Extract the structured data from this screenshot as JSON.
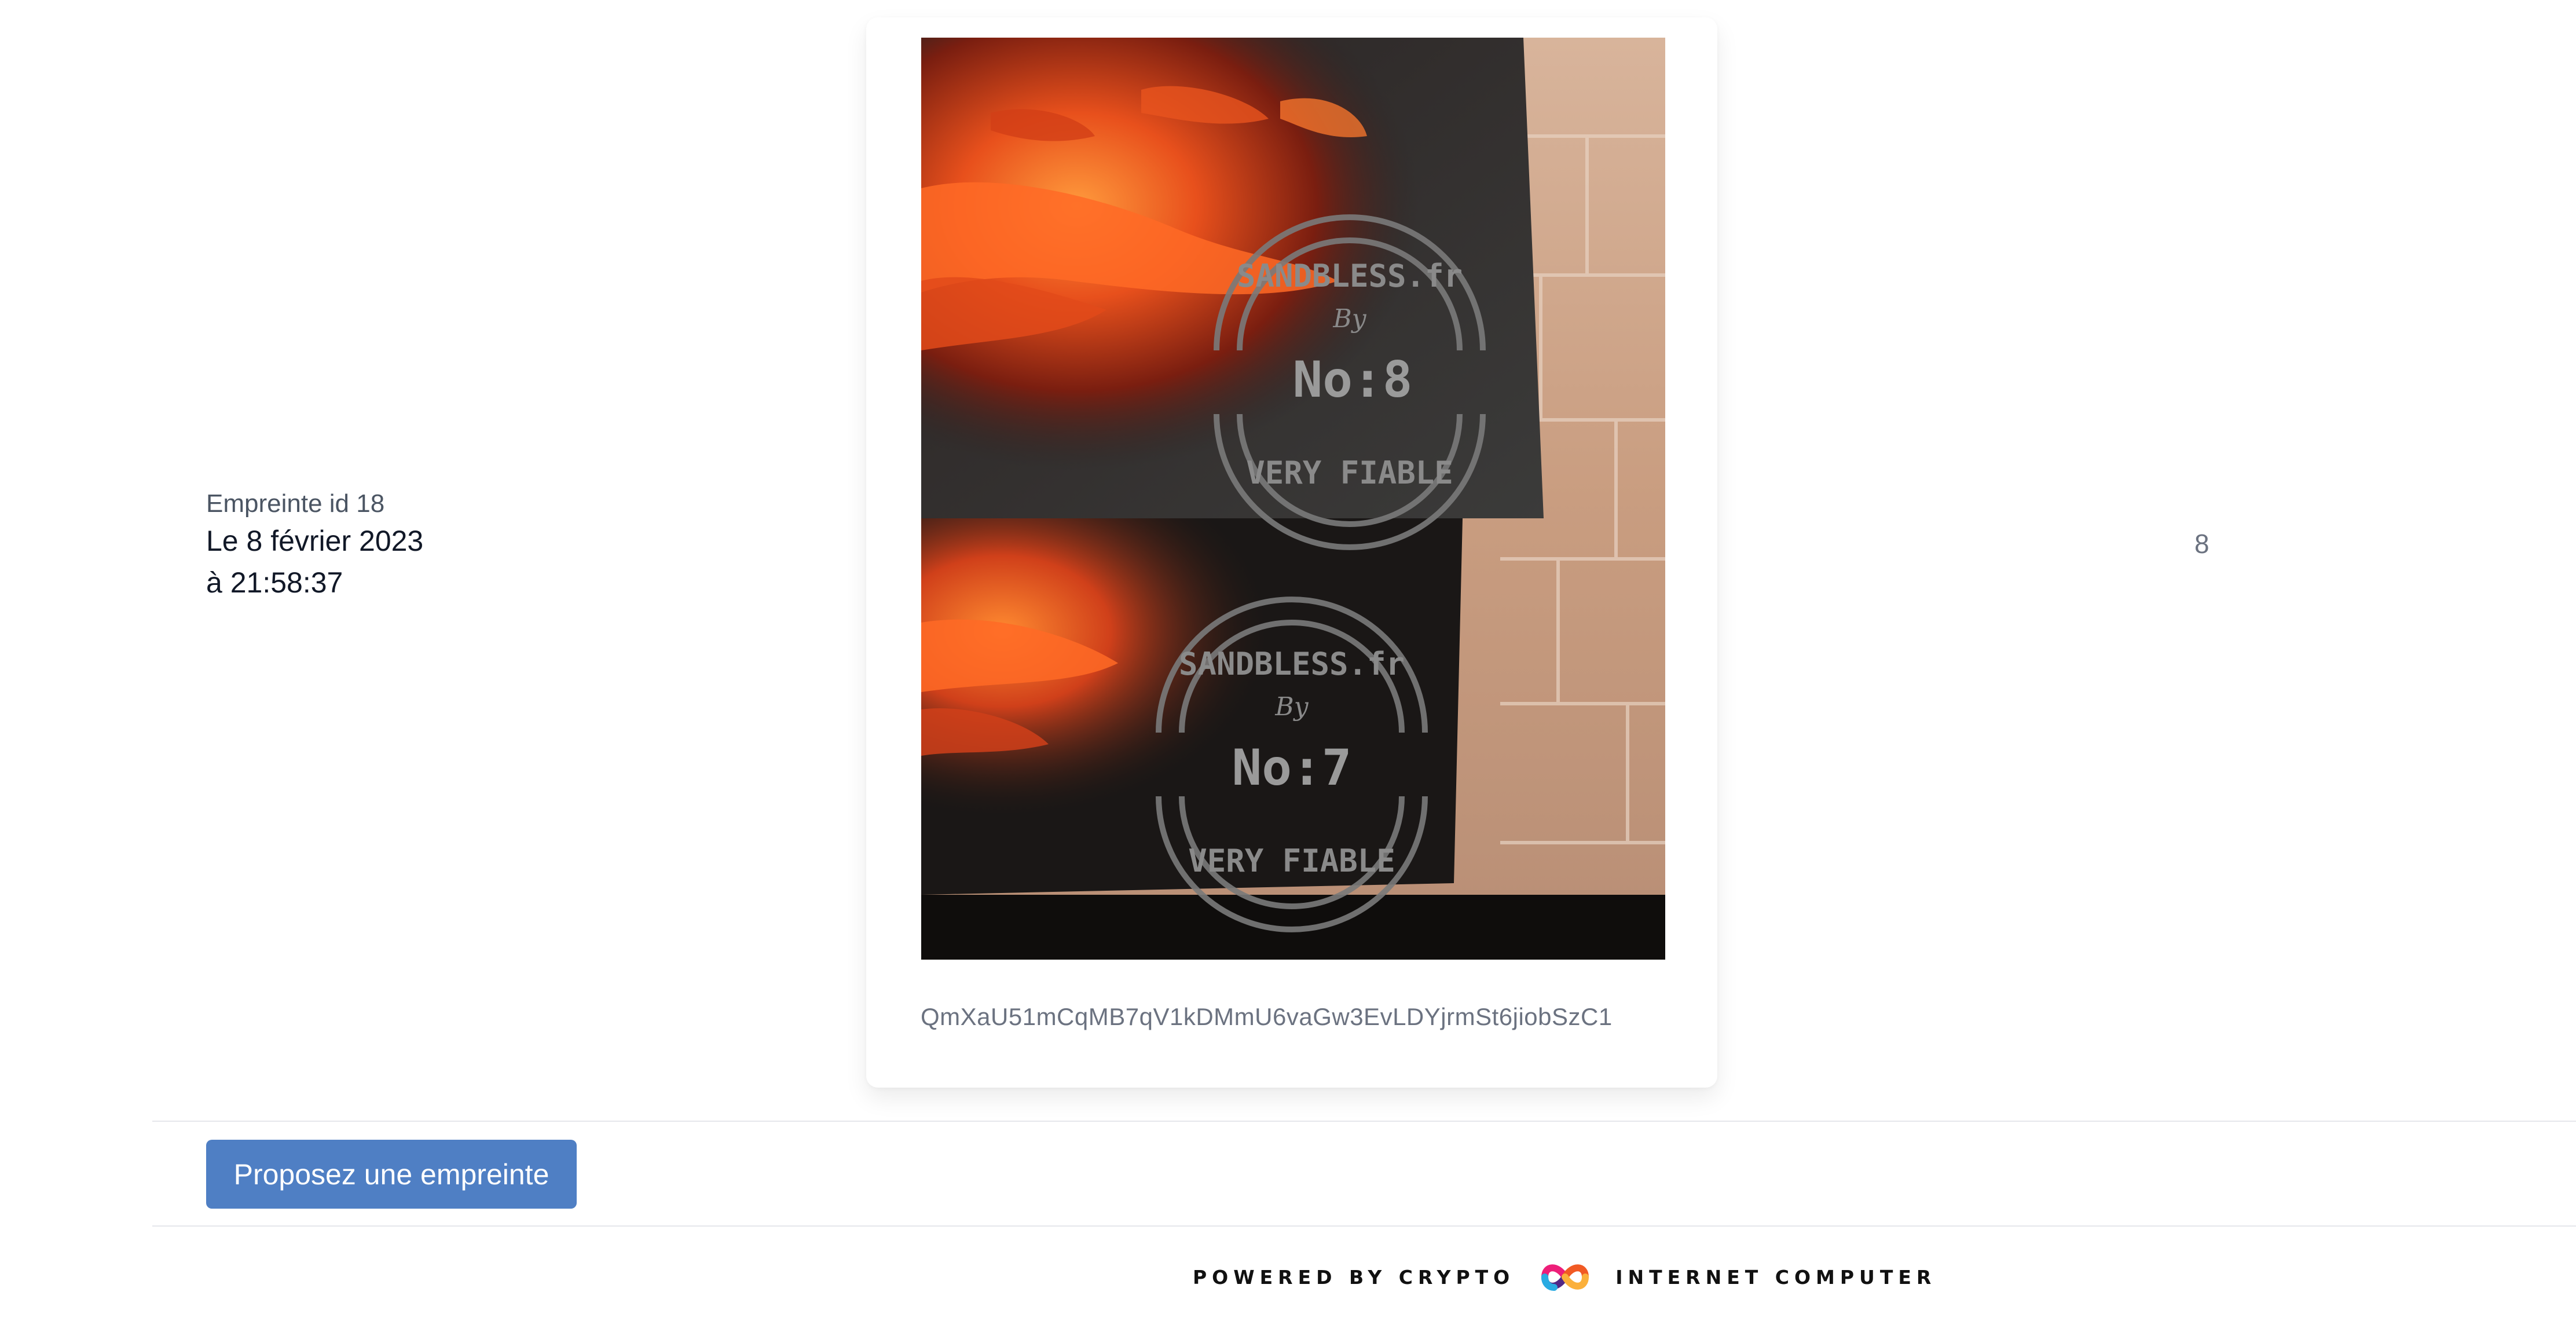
{
  "fingerprint": {
    "id_label": "Empreinte id 18",
    "date": "Le 8 février 2023",
    "time": "à 21:58:37"
  },
  "photo": {
    "stamps": [
      {
        "top_text": "SANDBLESS.fr",
        "middle": "By",
        "number": "No:8",
        "bottom_text": "VERY FIABLE"
      },
      {
        "top_text": "SANDBLESS.fr",
        "middle": "By",
        "number": "No:7",
        "bottom_text": "VERY FIABLE"
      }
    ]
  },
  "hash": "QmXaU51mCqMB7qV1kDMmU6vaGw3EvLDYjrmSt6jiobSzC1",
  "count": "8",
  "actions": {
    "propose_label": "Proposez une empreinte"
  },
  "footer": {
    "left_text": "POWERED BY CRYPTO",
    "right_text": "INTERNET COMPUTER",
    "logo_colors": [
      "#f15a24",
      "#ed1e79",
      "#522785",
      "#29abe2",
      "#fbb03b"
    ]
  }
}
